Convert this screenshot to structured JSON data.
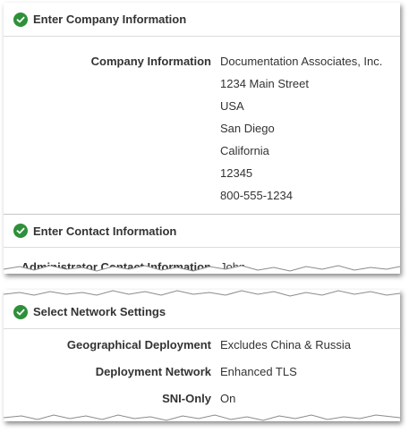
{
  "colors": {
    "check_green": "#2f8f3a",
    "text": "#333333"
  },
  "company_section": {
    "title": "Enter Company Information",
    "icon": "check-circle-icon",
    "label": "Company Information",
    "lines": [
      "Documentation Associates, Inc.",
      "1234 Main Street",
      "USA",
      "San Diego",
      "California",
      "12345",
      "800-555-1234"
    ]
  },
  "contact_section": {
    "title": "Enter Contact Information",
    "icon": "check-circle-icon",
    "label": "Administrator Contact Information",
    "value": "John"
  },
  "network_section": {
    "title": "Select Network Settings",
    "icon": "check-circle-icon",
    "rows": [
      {
        "label": "Geographical Deployment",
        "value": "Excludes China & Russia"
      },
      {
        "label": "Deployment Network",
        "value": "Enhanced TLS"
      },
      {
        "label": "SNI-Only",
        "value": "On"
      }
    ]
  }
}
